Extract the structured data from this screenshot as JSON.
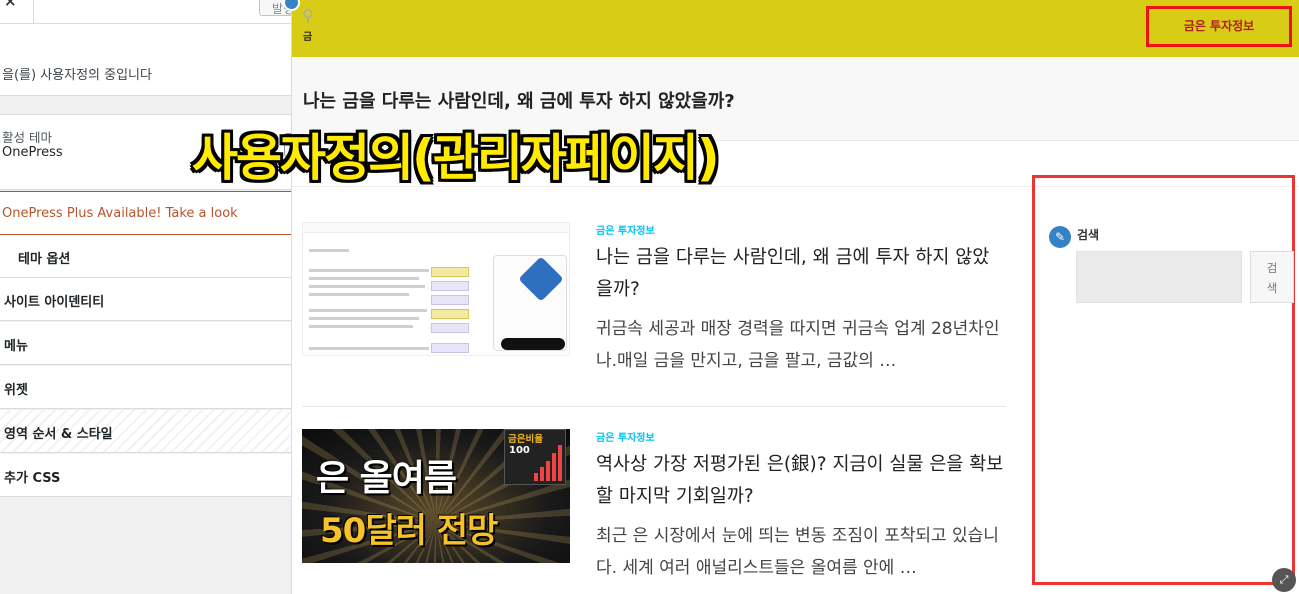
{
  "customizer": {
    "close_label": "×",
    "publish_label": "발행",
    "info_text": "을(를) 사용자정의 중입니다",
    "active_theme_label": "활성 테마",
    "theme_name": "OnePress",
    "promo_text": "OnePress Plus Available! Take a look",
    "sections": [
      {
        "label": "테마 옵션"
      },
      {
        "label": "사이트 아이덴티티"
      },
      {
        "label": "메뉴"
      },
      {
        "label": "위젯"
      },
      {
        "label": "영역 순서 & 스타일"
      },
      {
        "label": "추가 CSS"
      }
    ]
  },
  "site": {
    "logo_text": "금",
    "nav_item": "금은 투자정보",
    "page_title": "나는 금을 다루는 사람인데, 왜 금에 투자 하지 않았을까?",
    "posts": [
      {
        "category": "금은 투자정보",
        "title": "나는 금을 다루는 사람인데, 왜 금에 투자 하지 않았을까?",
        "excerpt": "귀금속 세공과 매장 경력을 따지면 귀금속 업계 28년차인 나.매일 금을 만지고, 금을 팔고, 금값의 …"
      },
      {
        "category": "금은 투자정보",
        "title": "역사상 가장 저평가된 은(銀)? 지금이 실물 은을 확보할 마지막 기회일까?",
        "excerpt": "최근 은 시장에서 눈에 띄는 변동 조짐이 포착되고 있습니다. 세계 여러 애널리스트들은 올여름 안에 …",
        "thumb_line1": "은 올여름",
        "thumb_line2": "50달러 전망",
        "thumb_badge_title": "금은비율",
        "thumb_badge_value": "100"
      }
    ],
    "search_widget": {
      "title": "검색",
      "button_label": "검색"
    }
  },
  "overlay_caption": "사용자정의(관리자페이지)",
  "colors": {
    "header_bg": "#d8cc16",
    "highlight_border": "#ee3333",
    "category_link": "#03c4eb",
    "promo": "#b6542b",
    "caption": "#ffea00"
  }
}
